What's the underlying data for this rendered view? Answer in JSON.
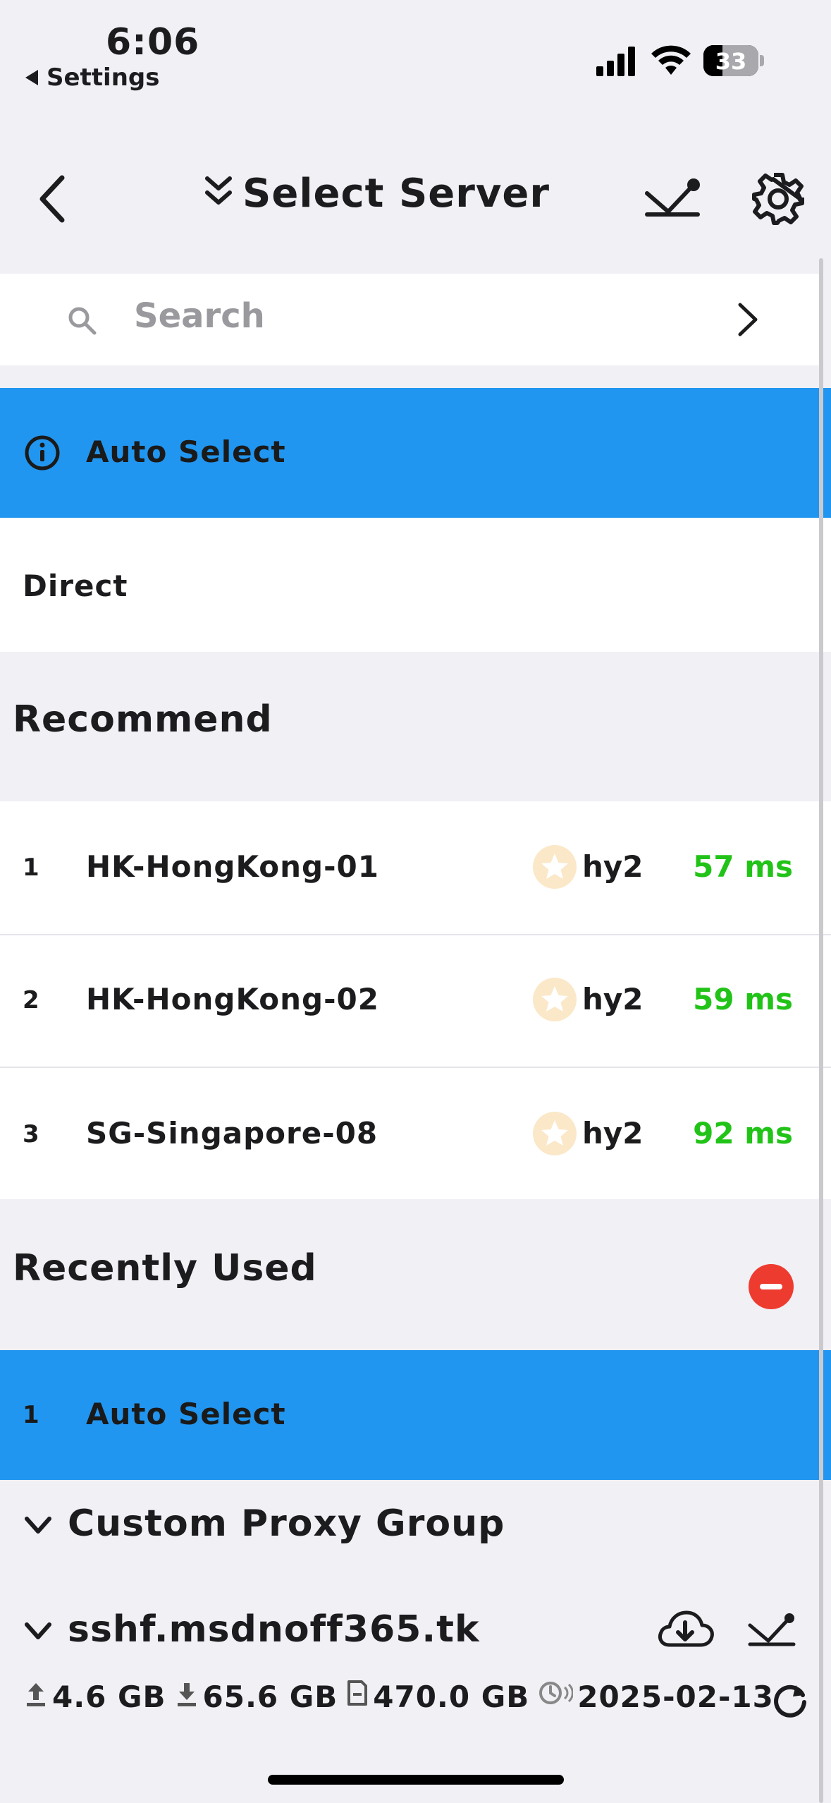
{
  "status_bar": {
    "time": "6:06",
    "back_app": "Settings",
    "battery": "33"
  },
  "nav": {
    "title": "Select Server"
  },
  "search": {
    "placeholder": "Search"
  },
  "auto_select": {
    "label": "Auto Select",
    "selected": true
  },
  "direct": {
    "label": "Direct"
  },
  "recommend": {
    "title": "Recommend",
    "items": [
      {
        "index": "1",
        "name": "HK-HongKong-01",
        "protocol": "hy2",
        "latency": "57 ms"
      },
      {
        "index": "2",
        "name": "HK-HongKong-02",
        "protocol": "hy2",
        "latency": "59 ms"
      },
      {
        "index": "3",
        "name": "SG-Singapore-08",
        "protocol": "hy2",
        "latency": "92 ms"
      }
    ]
  },
  "recently_used": {
    "title": "Recently Used",
    "items": [
      {
        "index": "1",
        "name": "Auto Select",
        "selected": true
      }
    ]
  },
  "custom_group": {
    "title": "Custom Proxy Group"
  },
  "subscription": {
    "name": "sshf.msdnoff365.tk",
    "upload": "4.6 GB",
    "download": "65.6 GB",
    "total": "470.0 GB",
    "expires": "2025-02-13"
  },
  "colors": {
    "accent": "#2196f0",
    "latency": "#22c318",
    "remove": "#ee3b30",
    "background": "#f0f0f5"
  }
}
